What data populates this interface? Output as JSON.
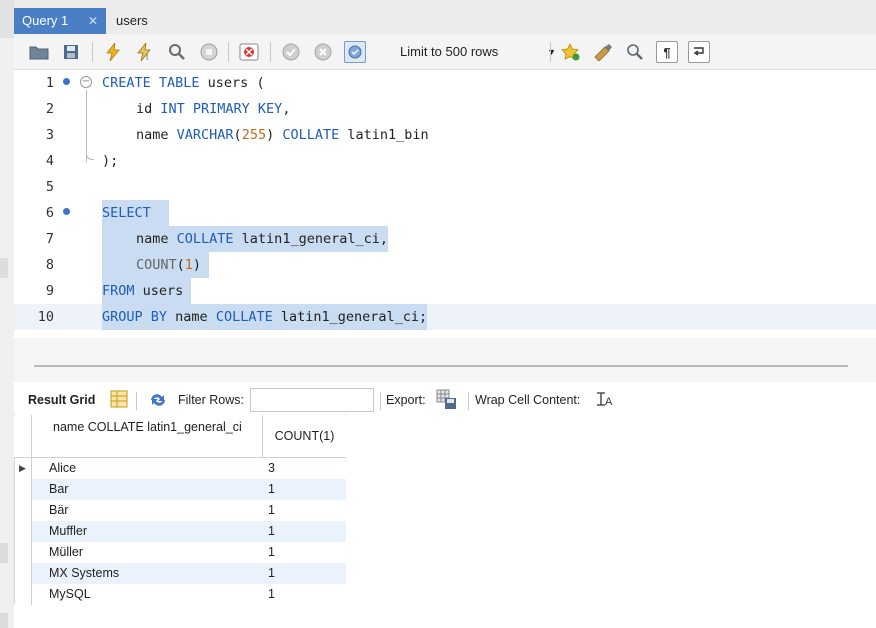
{
  "tabs": [
    {
      "label": "Query 1",
      "active": true
    },
    {
      "label": "users",
      "active": false
    }
  ],
  "toolbar": {
    "icons": [
      "open-folder-icon",
      "save-icon",
      "execute-icon",
      "execute-current-icon",
      "explain-icon",
      "stop-icon",
      "toggle-error-icon",
      "commit-icon",
      "rollback-icon",
      "autocommit-icon",
      "bookmark-icon",
      "beautify-icon",
      "find-icon",
      "invisible-chars-icon",
      "wrap-icon"
    ],
    "limit_label": "Limit to 500 rows"
  },
  "editor": {
    "lines": [
      {
        "n": "1"
      },
      {
        "n": "2"
      },
      {
        "n": "3"
      },
      {
        "n": "4"
      },
      {
        "n": "5"
      },
      {
        "n": "6"
      },
      {
        "n": "7"
      },
      {
        "n": "8"
      },
      {
        "n": "9"
      },
      {
        "n": "10"
      }
    ],
    "tokens": {
      "l1_kw": "CREATE TABLE",
      "l1_rest": " users (",
      "l2_a": "id ",
      "l2_kw": "INT PRIMARY KEY",
      "l2_b": ",",
      "l3_a": "name ",
      "l3_kw1": "VARCHAR",
      "l3_p1": "(",
      "l3_num": "255",
      "l3_p2": ") ",
      "l3_kw2": "COLLATE",
      "l3_b": " latin1_bin",
      "l4": ");",
      "l6_kw": "SELECT",
      "l7_a": "name ",
      "l7_kw": "COLLATE",
      "l7_b": " latin1_general_ci,",
      "l8_fn": "COUNT",
      "l8_p1": "(",
      "l8_num": "1",
      "l8_p2": ")",
      "l9_kw": "FROM",
      "l9_b": " users",
      "l10_kw1": "GROUP BY",
      "l10_a": " name ",
      "l10_kw2": "COLLATE",
      "l10_b": " latin1_general_ci;"
    }
  },
  "results_toolbar": {
    "result_grid": "Result Grid",
    "filter_rows": "Filter Rows:",
    "filter_value": "",
    "export": "Export:",
    "wrap": "Wrap Cell Content:"
  },
  "grid": {
    "columns": [
      "name COLLATE latin1_general_ci",
      "COUNT(1)"
    ],
    "rows": [
      [
        "Alice",
        "3"
      ],
      [
        "Bar",
        "1"
      ],
      [
        "Bär",
        "1"
      ],
      [
        "Muffler",
        "1"
      ],
      [
        "Müller",
        "1"
      ],
      [
        "MX Systems",
        "1"
      ],
      [
        "MySQL",
        "1"
      ]
    ]
  },
  "colors": {
    "tab_active": "#4a7fc5",
    "keyword": "#1f5db8",
    "number": "#c46a1b",
    "selection": "#c9dcf1",
    "grid_alt": "#eaf2fb"
  }
}
